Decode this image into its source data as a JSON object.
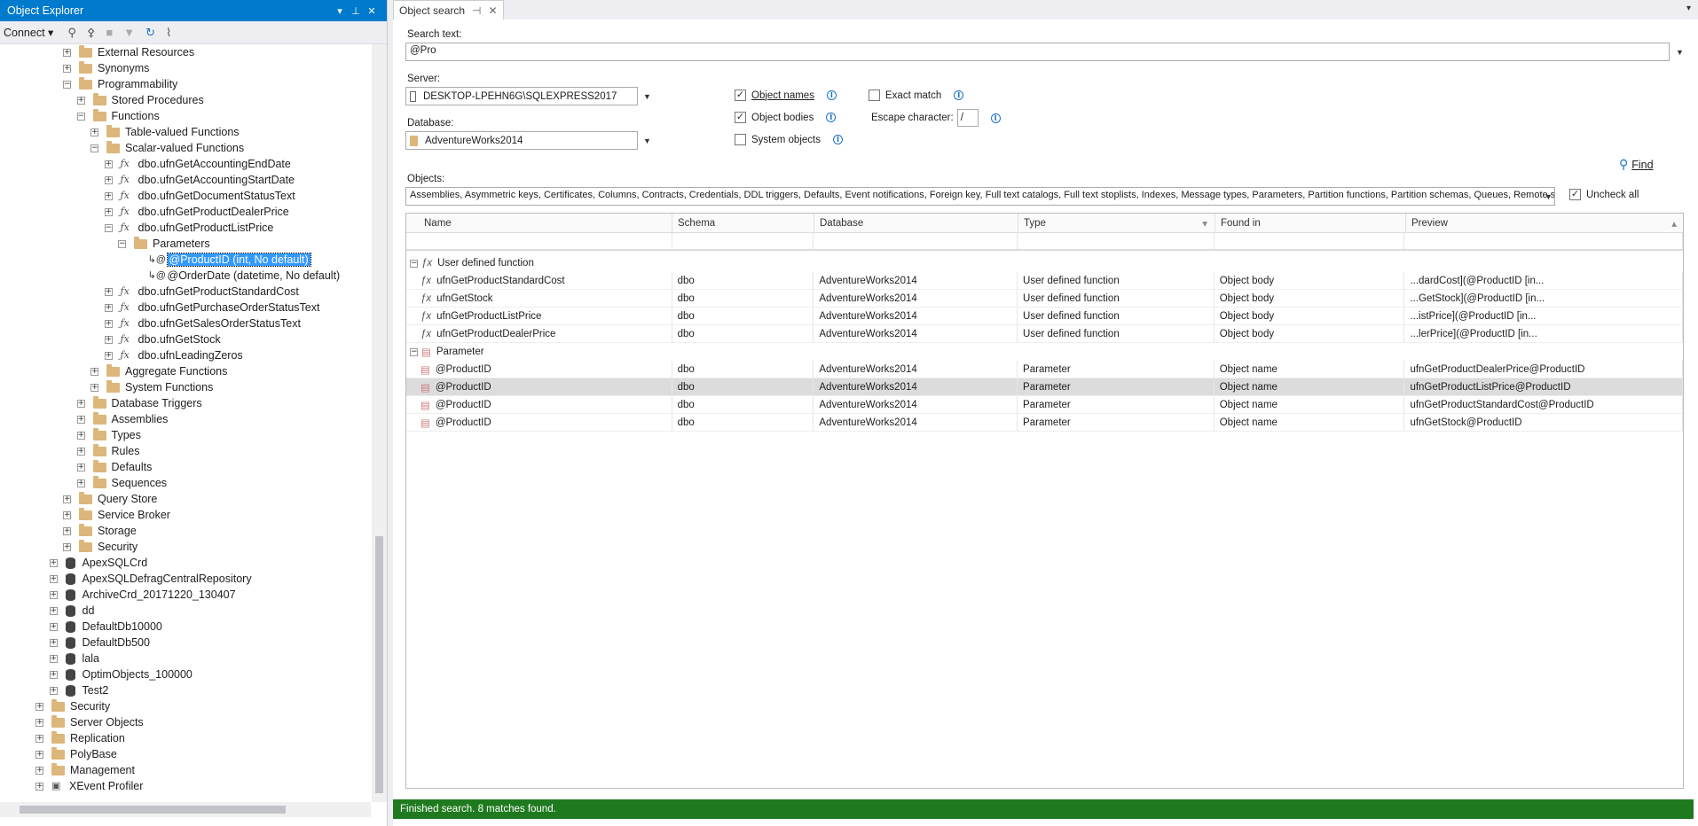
{
  "object_explorer": {
    "title": "Object Explorer",
    "connect_label": "Connect",
    "tree": [
      {
        "label": "External Resources",
        "icon": "folder",
        "level": 4,
        "expander": "+"
      },
      {
        "label": "Synonyms",
        "icon": "folder",
        "level": 4,
        "expander": "+"
      },
      {
        "label": "Programmability",
        "icon": "folder",
        "level": 4,
        "expander": "-"
      },
      {
        "label": "Stored Procedures",
        "icon": "folder",
        "level": 5,
        "expander": "+"
      },
      {
        "label": "Functions",
        "icon": "folder",
        "level": 5,
        "expander": "-"
      },
      {
        "label": "Table-valued Functions",
        "icon": "folder",
        "level": 6,
        "expander": "+"
      },
      {
        "label": "Scalar-valued Functions",
        "icon": "folder",
        "level": 6,
        "expander": "-"
      },
      {
        "label": "dbo.ufnGetAccountingEndDate",
        "icon": "function",
        "level": 7,
        "expander": "+"
      },
      {
        "label": "dbo.ufnGetAccountingStartDate",
        "icon": "function",
        "level": 7,
        "expander": "+"
      },
      {
        "label": "dbo.ufnGetDocumentStatusText",
        "icon": "function",
        "level": 7,
        "expander": "+"
      },
      {
        "label": "dbo.ufnGetProductDealerPrice",
        "icon": "function",
        "level": 7,
        "expander": "+"
      },
      {
        "label": "dbo.ufnGetProductListPrice",
        "icon": "function",
        "level": 7,
        "expander": "-"
      },
      {
        "label": "Parameters",
        "icon": "folder",
        "level": 8,
        "expander": "-"
      },
      {
        "label": "@ProductID (int, No default)",
        "icon": "parameter",
        "level": 9,
        "expander": "",
        "selected": true
      },
      {
        "label": "@OrderDate (datetime, No default)",
        "icon": "parameter",
        "level": 9,
        "expander": ""
      },
      {
        "label": "dbo.ufnGetProductStandardCost",
        "icon": "function",
        "level": 7,
        "expander": "+"
      },
      {
        "label": "dbo.ufnGetPurchaseOrderStatusText",
        "icon": "function",
        "level": 7,
        "expander": "+"
      },
      {
        "label": "dbo.ufnGetSalesOrderStatusText",
        "icon": "function",
        "level": 7,
        "expander": "+"
      },
      {
        "label": "dbo.ufnGetStock",
        "icon": "function",
        "level": 7,
        "expander": "+"
      },
      {
        "label": "dbo.ufnLeadingZeros",
        "icon": "function",
        "level": 7,
        "expander": "+"
      },
      {
        "label": "Aggregate Functions",
        "icon": "folder",
        "level": 6,
        "expander": "+"
      },
      {
        "label": "System Functions",
        "icon": "folder",
        "level": 6,
        "expander": "+"
      },
      {
        "label": "Database Triggers",
        "icon": "folder",
        "level": 5,
        "expander": "+"
      },
      {
        "label": "Assemblies",
        "icon": "folder",
        "level": 5,
        "expander": "+"
      },
      {
        "label": "Types",
        "icon": "folder",
        "level": 5,
        "expander": "+"
      },
      {
        "label": "Rules",
        "icon": "folder",
        "level": 5,
        "expander": "+"
      },
      {
        "label": "Defaults",
        "icon": "folder",
        "level": 5,
        "expander": "+"
      },
      {
        "label": "Sequences",
        "icon": "folder",
        "level": 5,
        "expander": "+"
      },
      {
        "label": "Query Store",
        "icon": "folder",
        "level": 4,
        "expander": "+"
      },
      {
        "label": "Service Broker",
        "icon": "folder",
        "level": 4,
        "expander": "+"
      },
      {
        "label": "Storage",
        "icon": "folder",
        "level": 4,
        "expander": "+"
      },
      {
        "label": "Security",
        "icon": "folder",
        "level": 4,
        "expander": "+"
      },
      {
        "label": "ApexSQLCrd",
        "icon": "database",
        "level": 3,
        "expander": "+"
      },
      {
        "label": "ApexSQLDefragCentralRepository",
        "icon": "database",
        "level": 3,
        "expander": "+"
      },
      {
        "label": "ArchiveCrd_20171220_130407",
        "icon": "database",
        "level": 3,
        "expander": "+"
      },
      {
        "label": "dd",
        "icon": "database",
        "level": 3,
        "expander": "+"
      },
      {
        "label": "DefaultDb10000",
        "icon": "database",
        "level": 3,
        "expander": "+"
      },
      {
        "label": "DefaultDb500",
        "icon": "database",
        "level": 3,
        "expander": "+"
      },
      {
        "label": "lala",
        "icon": "database",
        "level": 3,
        "expander": "+"
      },
      {
        "label": "OptimObjects_100000",
        "icon": "database",
        "level": 3,
        "expander": "+"
      },
      {
        "label": "Test2",
        "icon": "database",
        "level": 3,
        "expander": "+"
      },
      {
        "label": "Security",
        "icon": "folder",
        "level": 2,
        "expander": "+"
      },
      {
        "label": "Server Objects",
        "icon": "folder",
        "level": 2,
        "expander": "+"
      },
      {
        "label": "Replication",
        "icon": "folder",
        "level": 2,
        "expander": "+"
      },
      {
        "label": "PolyBase",
        "icon": "folder",
        "level": 2,
        "expander": "+"
      },
      {
        "label": "Management",
        "icon": "folder",
        "level": 2,
        "expander": "+"
      },
      {
        "label": "XEvent Profiler",
        "icon": "profiler",
        "level": 2,
        "expander": "+"
      }
    ]
  },
  "object_search": {
    "tab_label": "Object search",
    "search_text_label": "Search text:",
    "search_text_value": "@Pro",
    "server_label": "Server:",
    "server_value": "DESKTOP-LPEHN6G\\SQLEXPRESS2017",
    "database_label": "Database:",
    "database_value": "AdventureWorks2014",
    "object_names_label": "Object names",
    "object_bodies_label": "Object bodies",
    "system_objects_label": "System objects",
    "exact_match_label": "Exact match",
    "escape_character_label": "Escape character:",
    "escape_character_value": "/",
    "find_label": "Find",
    "objects_label": "Objects:",
    "objects_value": "Assemblies, Asymmetric keys, Certificates, Columns, Contracts, Credentials, DDL triggers, Defaults, Event notifications, Foreign key, Full text catalogs, Full text stoplists, Indexes, Message types, Parameters, Partition functions, Partition schemas, Queues, Remote s",
    "uncheck_all_label": "Uncheck all",
    "columns": [
      "Name",
      "Schema",
      "Database",
      "Type",
      "Found in",
      "Preview"
    ],
    "groups": [
      {
        "label": "User defined function",
        "icon": "function",
        "rows": [
          {
            "name": "ufnGetProductStandardCost",
            "schema": "dbo",
            "database": "AdventureWorks2014",
            "type": "User defined function",
            "found_in": "Object body",
            "preview": "...dardCost](@ProductID [in..."
          },
          {
            "name": "ufnGetStock",
            "schema": "dbo",
            "database": "AdventureWorks2014",
            "type": "User defined function",
            "found_in": "Object body",
            "preview": "...GetStock](@ProductID [in..."
          },
          {
            "name": "ufnGetProductListPrice",
            "schema": "dbo",
            "database": "AdventureWorks2014",
            "type": "User defined function",
            "found_in": "Object body",
            "preview": "...istPrice](@ProductID [in..."
          },
          {
            "name": "ufnGetProductDealerPrice",
            "schema": "dbo",
            "database": "AdventureWorks2014",
            "type": "User defined function",
            "found_in": "Object body",
            "preview": "...lerPrice](@ProductID [in..."
          }
        ]
      },
      {
        "label": "Parameter",
        "icon": "parameter",
        "rows": [
          {
            "name": "@ProductID",
            "schema": "dbo",
            "database": "AdventureWorks2014",
            "type": "Parameter",
            "found_in": "Object name",
            "preview": "ufnGetProductDealerPrice@ProductID"
          },
          {
            "name": "@ProductID",
            "schema": "dbo",
            "database": "AdventureWorks2014",
            "type": "Parameter",
            "found_in": "Object name",
            "preview": "ufnGetProductListPrice@ProductID",
            "highlighted": true
          },
          {
            "name": "@ProductID",
            "schema": "dbo",
            "database": "AdventureWorks2014",
            "type": "Parameter",
            "found_in": "Object name",
            "preview": "ufnGetProductStandardCost@ProductID"
          },
          {
            "name": "@ProductID",
            "schema": "dbo",
            "database": "AdventureWorks2014",
            "type": "Parameter",
            "found_in": "Object name",
            "preview": "ufnGetStock@ProductID"
          }
        ]
      }
    ],
    "status_text": "Finished search. 8 matches found.",
    "status_color": "#1f7a1f"
  }
}
